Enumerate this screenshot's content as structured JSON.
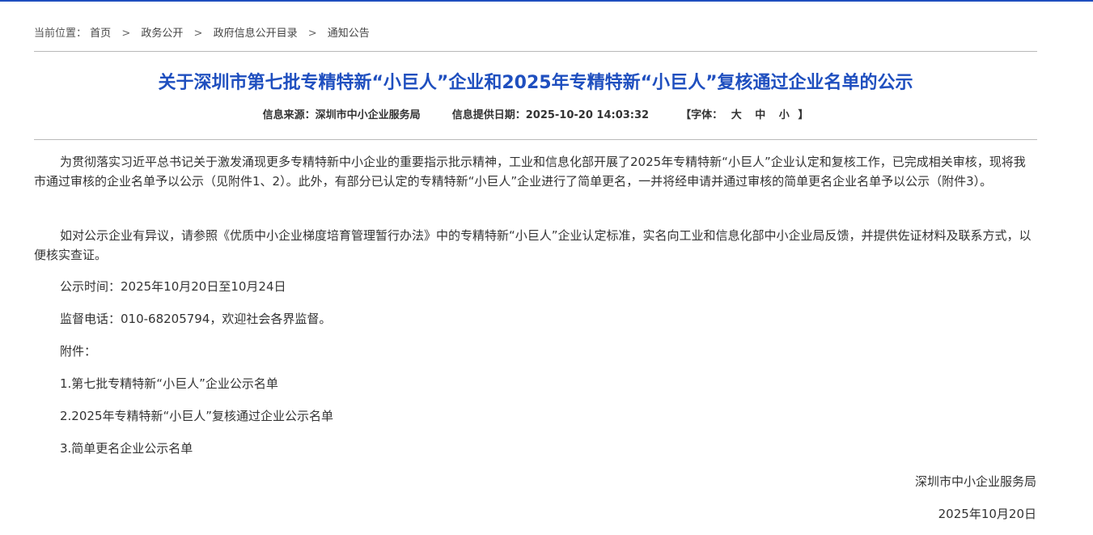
{
  "breadcrumb": {
    "prefix": "当前位置：",
    "items": [
      {
        "label": "首页"
      },
      {
        "label": "政务公开"
      },
      {
        "label": "政府信息公开目录"
      },
      {
        "label": "通知公告"
      }
    ],
    "separator": ">"
  },
  "article": {
    "title": "关于深圳市第七批专精特新“小巨人”企业和2025年专精特新“小巨人”复核通过企业名单的公示",
    "meta": {
      "source_label": "信息来源：",
      "source": "深圳市中小企业服务局",
      "date_label": "信息提供日期：",
      "date": "2025-10-20 14:03:32",
      "font_label": "【字体：",
      "font_large": "大",
      "font_medium": "中",
      "font_small": "小",
      "font_close": "】"
    },
    "paragraphs": [
      "为贯彻落实习近平总书记关于激发涌现更多专精特新中小企业的重要指示批示精神，工业和信息化部开展了2025年专精特新“小巨人”企业认定和复核工作，已完成相关审核，现将我市通过审核的企业名单予以公示（见附件1、2）。此外，有部分已认定的专精特新“小巨人”企业进行了简单更名，一并将经申请并通过审核的简单更名企业名单予以公示（附件3）。",
      "如对公示企业有异议，请参照《优质中小企业梯度培育管理暂行办法》中的专精特新“小巨人”企业认定标准，实名向工业和信息化部中小企业局反馈，并提供佐证材料及联系方式，以便核实查证。",
      "公示时间：2025年10月20日至10月24日",
      "监督电话：010-68205794，欢迎社会各界监督。",
      "附件："
    ],
    "attachments": [
      "1.第七批专精特新“小巨人”企业公示名单",
      "2.2025年专精特新“小巨人”复核通过企业公示名单",
      "3.简单更名企业公示名单"
    ],
    "signature": {
      "org": "深圳市中小企业服务局",
      "date": "2025年10月20日"
    }
  },
  "colors": {
    "accent": "#1f4fbf",
    "text": "#333333",
    "rule": "#b9b9b9"
  }
}
